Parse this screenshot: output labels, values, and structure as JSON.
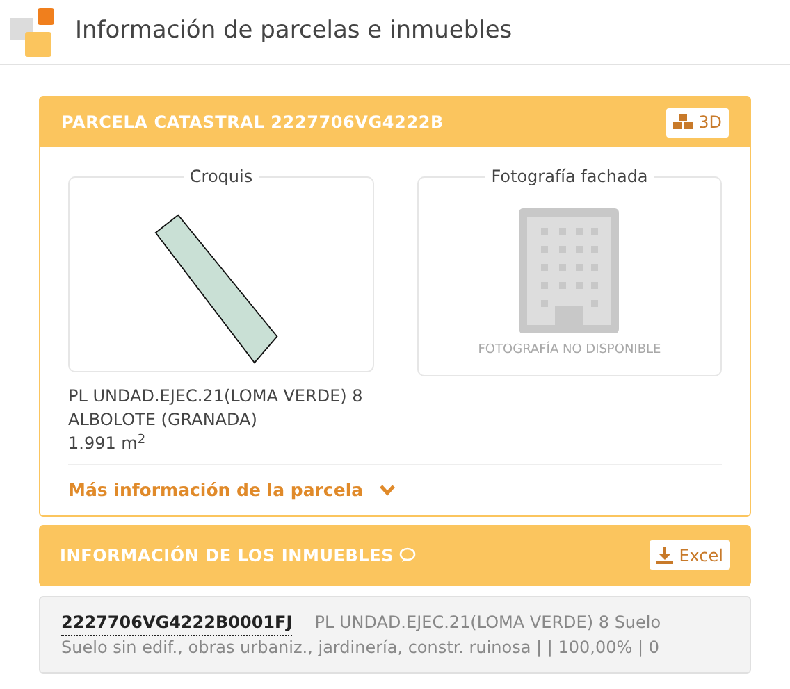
{
  "page_title": "Información de parcelas e inmuebles",
  "parcel": {
    "title": "PARCELA CATASTRAL 2227706VG4222B",
    "button_3d": "3D",
    "sketch": {
      "title": "Croquis"
    },
    "photo": {
      "title": "Fotografía fachada",
      "message": "FOTOGRAFÍA NO DISPONIBLE"
    },
    "address_lines": [
      "PL UNDAD.EJEC.21(LOMA VERDE) 8",
      "ALBOLOTE (GRANADA)",
      "1.991 m$^{2}$"
    ],
    "more_link": {
      "label": "Más información de la parcela",
      "expanded": false
    }
  },
  "properties": {
    "title": "INFORMACIÓN DE LOS INMUEBLES",
    "export_button": "Excel",
    "rows": [
      {
        "reference": "2227706VG4222B0001FJ",
        "address": "PL UNDAD.EJEC.21(LOMA VERDE) 8 Suelo",
        "details": "Suelo sin edif., obras urbaniz., jardinería, constr. ruinosa | | 100,00% | 0"
      }
    ]
  }
}
